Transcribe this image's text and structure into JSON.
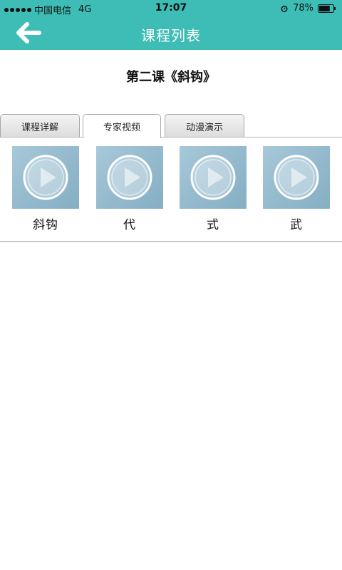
{
  "status_bar": {
    "carrier": "中国电信",
    "network": "4G",
    "time": "17:07",
    "battery": "78%",
    "battery_level": 0.78
  },
  "header": {
    "title": "课程列表",
    "back_icon": "arrow-left-icon",
    "color": "#3dbdb5"
  },
  "lesson": {
    "title": "第二课《斜钩》"
  },
  "tabs": [
    {
      "label": "课程详解",
      "active": false
    },
    {
      "label": "专家视频",
      "active": true
    },
    {
      "label": "动漫演示",
      "active": false
    }
  ],
  "videos": [
    {
      "label": "斜钩",
      "icon": "play-icon"
    },
    {
      "label": "代",
      "icon": "play-icon"
    },
    {
      "label": "式",
      "icon": "play-icon"
    },
    {
      "label": "武",
      "icon": "play-icon"
    }
  ]
}
